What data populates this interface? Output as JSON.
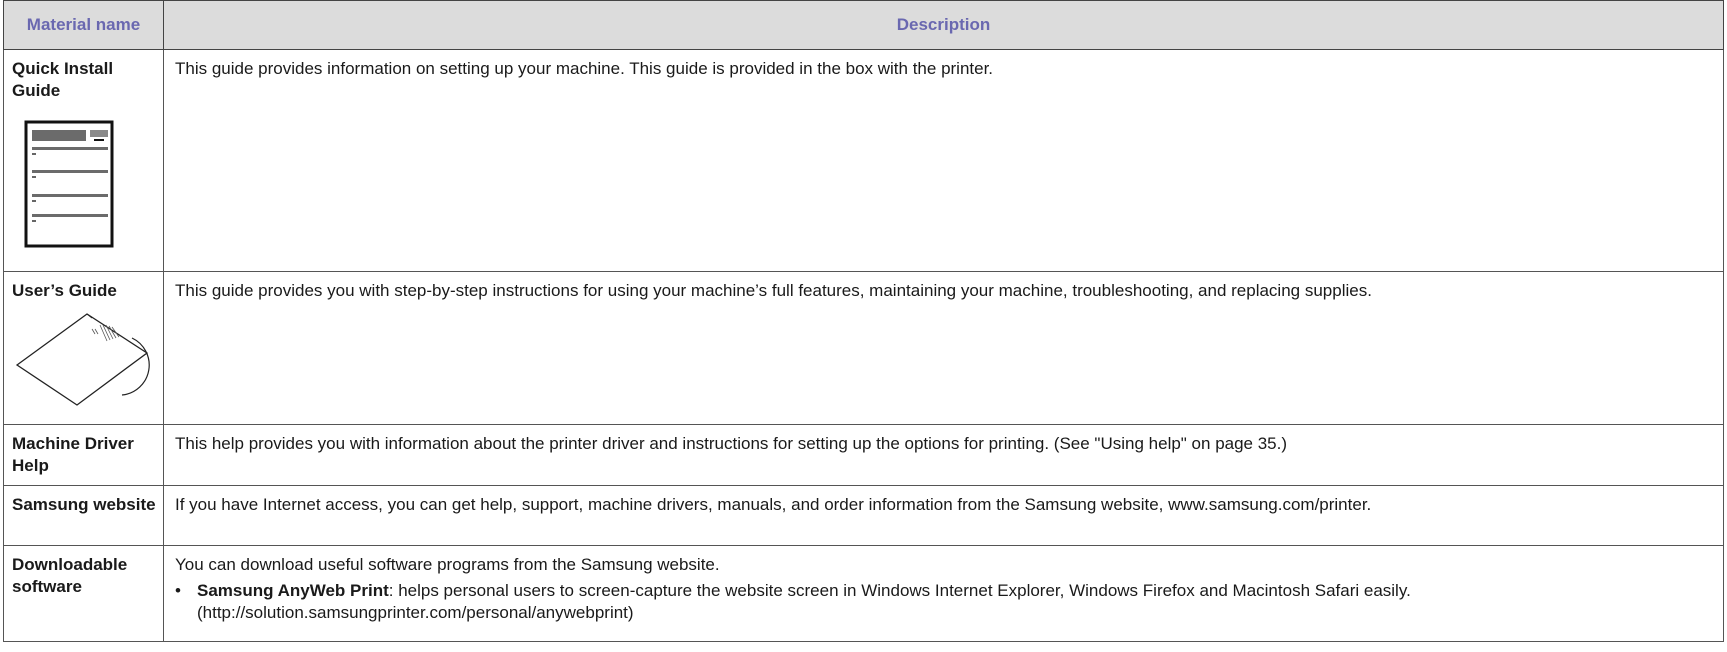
{
  "header": {
    "col1": "Material name",
    "col2": "Description"
  },
  "rows": [
    {
      "name": "Quick Install Guide",
      "icon": "booklet-icon",
      "description": "This guide provides information on setting up your machine. This guide is provided in the box with the printer."
    },
    {
      "name": "User’s Guide",
      "icon": "cd-sleeve-icon",
      "description": "This guide provides you with step-by-step instructions for using your machine’s full features, maintaining your machine, troubleshooting, and replacing supplies."
    },
    {
      "name": "Machine Driver Help",
      "description": "This help provides you with information about the printer driver and instructions for setting up the options for printing. (See \"Using help\" on page 35.)"
    },
    {
      "name": "Samsung website",
      "description": "If you have Internet access, you can get help, support, machine drivers, manuals, and order information from the Samsung website, www.samsung.com/printer."
    },
    {
      "name": "Downloadable software",
      "description": "You can download useful software programs from the Samsung website.",
      "bullet": {
        "marker": "•",
        "term": "Samsung AnyWeb Print",
        "text": ": helps personal users to screen-capture the website screen in Windows Internet Explorer, Windows Firefox and Macintosh Safari easily. (http://solution.samsungprinter.com/personal/anywebprint)"
      }
    }
  ]
}
